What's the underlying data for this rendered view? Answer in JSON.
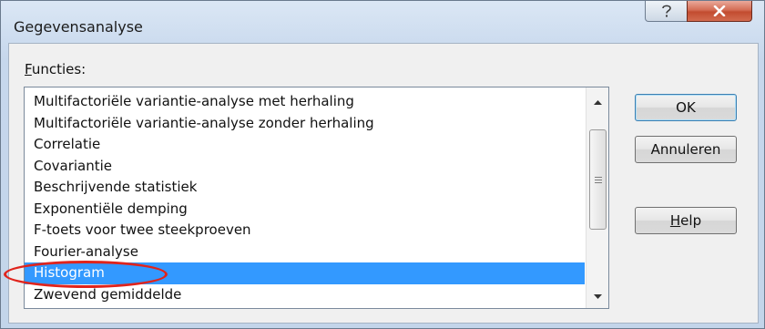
{
  "dialog": {
    "title": "Gegevensanalyse",
    "controls": {
      "help": "?",
      "close": "X"
    }
  },
  "list_label": {
    "accesskey": "F",
    "rest": "uncties:"
  },
  "functions": [
    "Multifactoriële variantie-analyse met herhaling",
    "Multifactoriële variantie-analyse zonder herhaling",
    "Correlatie",
    "Covariantie",
    "Beschrijvende statistiek",
    "Exponentiële demping",
    "F-toets voor twee steekproeven",
    "Fourier-analyse",
    "Histogram",
    "Zwevend gemiddelde"
  ],
  "selected_function": "Histogram",
  "buttons": {
    "ok": "OK",
    "cancel": "Annuleren",
    "help_accesskey": "H",
    "help_rest": "elp"
  },
  "colors": {
    "selection": "#3399ff",
    "annotation": "#e0241c",
    "close_button": "#c24c30"
  }
}
